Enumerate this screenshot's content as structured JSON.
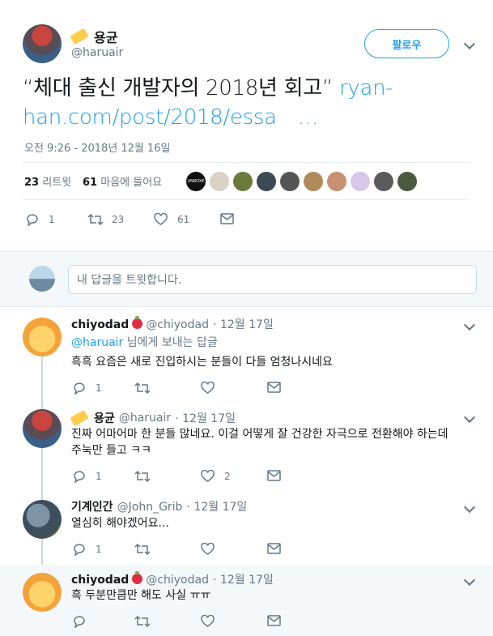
{
  "main_tweet": {
    "author_name": "용균",
    "author_handle": "@haruair",
    "follow_label": "팔로우",
    "text_quote": "“체대 출신 개발자의 2018년 회고”",
    "link_part1": "ryan-",
    "link_part2": "han.com/post/2018/essa",
    "link_ellipsis": "…",
    "timestamp": "오전 9:26 - 2018년 12월 16일",
    "retweets_count": "23",
    "retweets_label": "리트윗",
    "likes_count": "61",
    "likes_label": "마음에 들어요",
    "liker_avatars": [
      {
        "color": "#111111",
        "label": "UNBOXE"
      },
      {
        "color": "#d9d2c5",
        "label": ""
      },
      {
        "color": "#6b7a3a",
        "label": ""
      },
      {
        "color": "#3d4a55",
        "label": ""
      },
      {
        "color": "#555555",
        "label": ""
      },
      {
        "color": "#b08a58",
        "label": ""
      },
      {
        "color": "#c98f72",
        "label": ""
      },
      {
        "color": "#d8c7e6",
        "label": ""
      },
      {
        "color": "#5b5b5b",
        "label": ""
      },
      {
        "color": "#4a5a3c",
        "label": ""
      }
    ],
    "actions": {
      "reply": "1",
      "retweet": "23",
      "like": "61"
    }
  },
  "reply_box": {
    "placeholder": "내 답글을 트윗합니다."
  },
  "replies": [
    {
      "name": "chiyodad",
      "handle": "@chiyodad",
      "date": "· 12월 17일",
      "reply_to_handle": "@haruair",
      "reply_to_suffix": " 님에게 보내는 답글",
      "text": "흑흑 요즘은 새로 진입하시는 분들이 다들 엄청나시네요",
      "reply_count": "1",
      "like_count": ""
    },
    {
      "name": "용균",
      "handle": "@haruair",
      "date": "· 12월 17일",
      "text_line1": "진짜 어마어마 한 분들 많네요. 이걸 어떻게 잘 건강한 자극으로 전환해야 하는데",
      "text_line2": "주눅만 들고 ㅋㅋ",
      "reply_count": "1",
      "like_count": "2"
    },
    {
      "name": "기계인간",
      "handle": "@John_Grib",
      "date": "· 12월 17일",
      "text": "열심히 해야겠어요...",
      "reply_count": "1",
      "like_count": ""
    },
    {
      "name": "chiyodad",
      "handle": "@chiyodad",
      "date": "· 12월 17일",
      "text": "흑 두분만큼만 해도 사실 ㅠㅠ",
      "reply_count": "",
      "like_count": ""
    }
  ]
}
